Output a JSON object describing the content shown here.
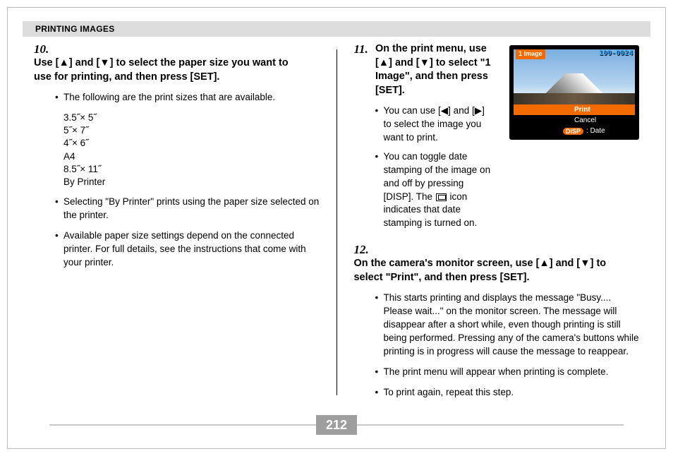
{
  "header": {
    "title": "PRINTING IMAGES"
  },
  "step10": {
    "num": "10.",
    "text": "Use [▲] and [▼] to select the paper size you want to use for printing, and then press [SET].",
    "bullet_intro": "The following are the print sizes that are available.",
    "sizes": [
      "3.5˝× 5˝",
      "5˝× 7˝",
      "4˝× 6˝",
      "A4",
      "8.5˝× 11˝",
      "By Printer"
    ],
    "bullet2": "Selecting \"By Printer\" prints using the paper size selected on the printer.",
    "bullet3": "Available paper size settings depend on the connected printer. For full details, see the instructions that come with your printer."
  },
  "step11": {
    "num": "11.",
    "text": "On the print menu, use [▲] and [▼] to select \"1 Image\", and then press [SET].",
    "bullet1": "You can use [◀] and [▶] to select the image you want to print.",
    "bullet2a": "You can toggle date stamping of the image on and off by pressing [DISP]. The ",
    "bullet2b": " icon indicates that date stamping is turned on."
  },
  "step12": {
    "num": "12.",
    "text": "On the camera's monitor screen, use [▲] and [▼] to select \"Print\", and then press [SET].",
    "bullet1": "This starts printing and displays the message \"Busy.... Please wait...\" on the monitor screen. The message will disappear after a short while, even though printing is still being performed. Pressing any of the camera's buttons while printing is in progress will cause the message to reappear.",
    "bullet2": "The print menu will appear when printing is complete.",
    "bullet3": "To print again, repeat this step."
  },
  "screen": {
    "badge": "1 Image",
    "counter": "100-0024",
    "print": "Print",
    "cancel": "Cancel",
    "disp_label": "DISP",
    "date_label": ": Date"
  },
  "page_number": "212"
}
